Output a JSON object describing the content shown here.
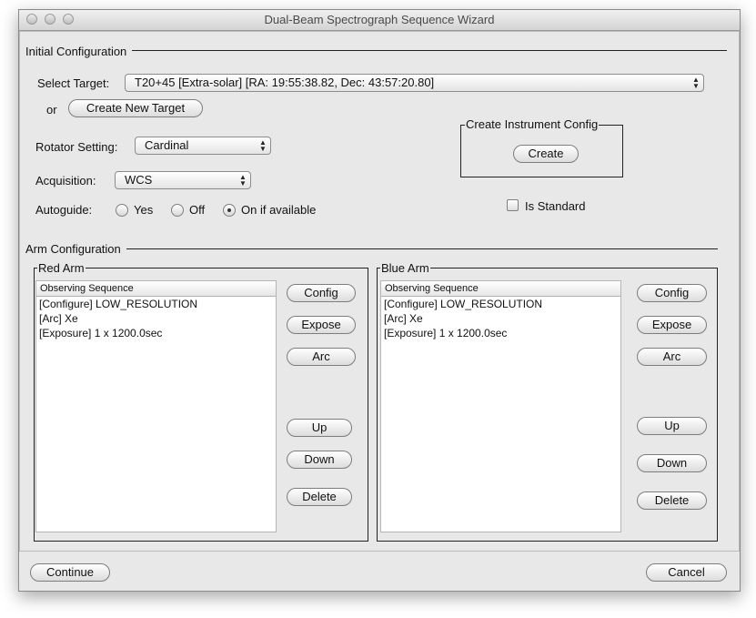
{
  "window": {
    "title": "Dual-Beam Spectrograph Sequence Wizard"
  },
  "initial_config": {
    "section_title": "Initial Configuration",
    "select_target_label": "Select Target:",
    "target_value": "T20+45 [Extra-solar] [RA:  19:55:38.82, Dec:  43:57:20.80]",
    "or_label": "or",
    "create_new_target": "Create New Target",
    "rotator_label": "Rotator Setting:",
    "rotator_value": "Cardinal",
    "acquisition_label": "Acquisition:",
    "acquisition_value": "WCS",
    "autoguide_label": "Autoguide:",
    "autoguide_options": [
      {
        "label": "Yes",
        "selected": false
      },
      {
        "label": "Off",
        "selected": false
      },
      {
        "label": "On if available",
        "selected": true
      }
    ],
    "instrument_config_title": "Create Instrument Config",
    "create_button": "Create",
    "is_standard_label": "Is Standard",
    "is_standard_checked": false
  },
  "arm_config": {
    "section_title": "Arm Configuration",
    "red_arm": {
      "title": "Red Arm",
      "list_header": "Observing Sequence",
      "items": [
        "[Configure] LOW_RESOLUTION",
        "[Arc] Xe",
        "[Exposure] 1 x 1200.0sec"
      ],
      "buttons": {
        "config": "Config",
        "expose": "Expose",
        "arc": "Arc",
        "up": "Up",
        "down": "Down",
        "delete": "Delete"
      }
    },
    "blue_arm": {
      "title": "Blue Arm",
      "list_header": "Observing Sequence",
      "items": [
        "[Configure] LOW_RESOLUTION",
        "[Arc] Xe",
        "[Exposure] 1 x 1200.0sec"
      ],
      "buttons": {
        "config": "Config",
        "expose": "Expose",
        "arc": "Arc",
        "up": "Up",
        "down": "Down",
        "delete": "Delete"
      }
    }
  },
  "footer": {
    "continue": "Continue",
    "cancel": "Cancel"
  },
  "icons": {
    "close": "close-icon",
    "minimize": "minimize-icon",
    "zoom": "zoom-icon",
    "select_arrows": "updown-arrows-icon"
  }
}
